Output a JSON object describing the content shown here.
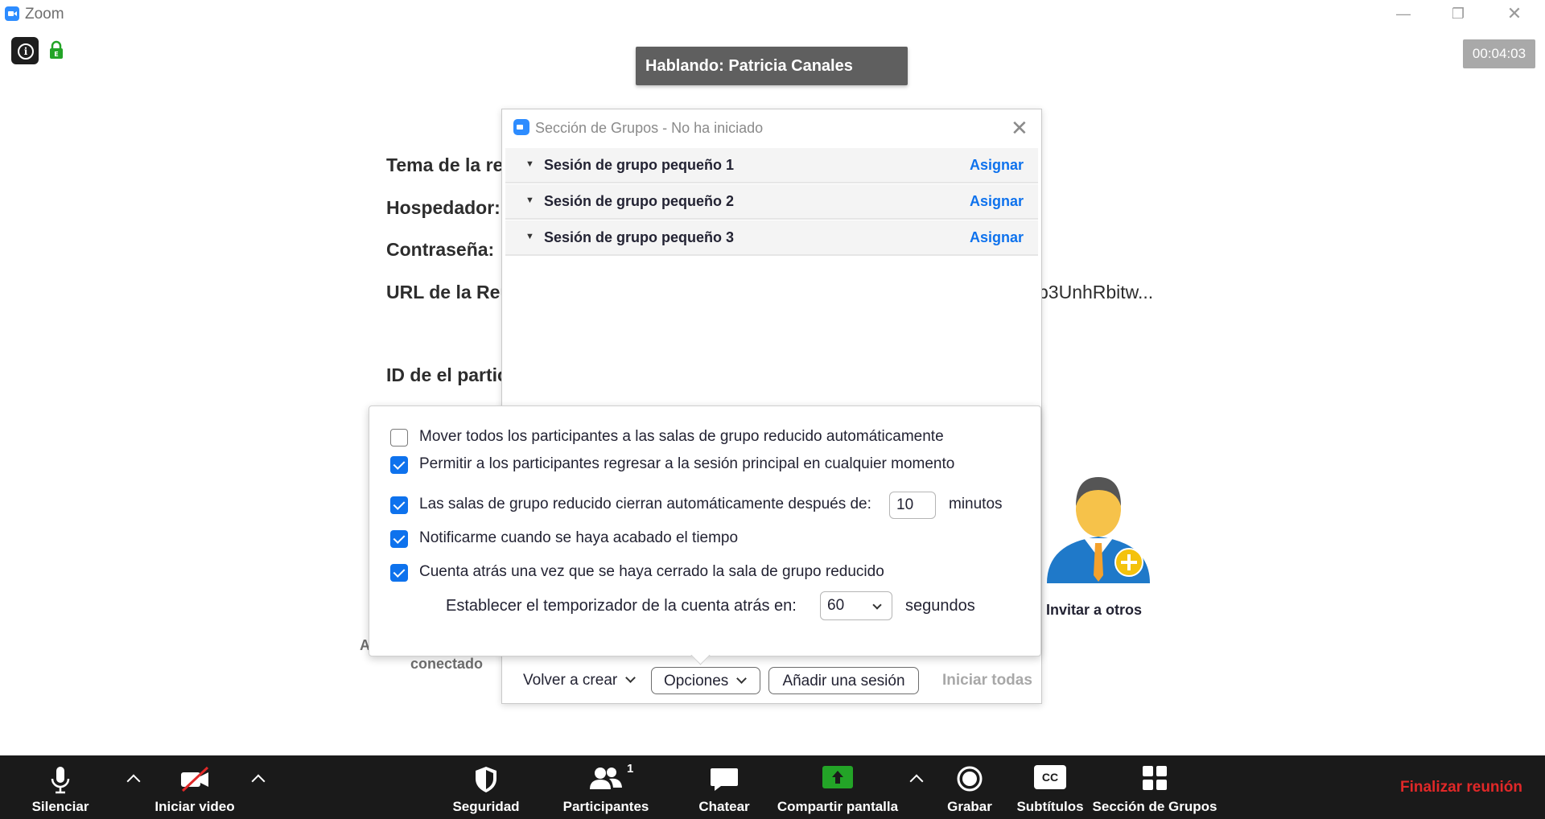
{
  "window": {
    "app_title": "Zoom",
    "timer": "00:04:03",
    "speaking": "Hablando: Patricia Canales"
  },
  "meeting_info": {
    "topic_label": "Tema de la re",
    "host_label": "Hospedador:",
    "password_label": "Contraseña:",
    "url_label": "URL de la Reu",
    "url_tail": "p3UnhRbitw...",
    "participant_id_label": "ID de el partic",
    "side_letter": "A",
    "connected": "conectado"
  },
  "invite": {
    "label": "Invitar a otros"
  },
  "breakout": {
    "title": "Sección de Grupos - No ha iniciado",
    "sessions": [
      {
        "name": "Sesión de grupo pequeño 1",
        "action": "Asignar"
      },
      {
        "name": "Sesión de grupo pequeño 2",
        "action": "Asignar"
      },
      {
        "name": "Sesión de grupo pequeño 3",
        "action": "Asignar"
      }
    ],
    "footer": {
      "recreate": "Volver a crear",
      "options": "Opciones",
      "add_session": "Añadir una sesión",
      "start_all": "Iniciar todas"
    },
    "options": {
      "auto_move": {
        "label": "Mover todos los participantes a las salas de grupo reducido automáticamente",
        "checked": false
      },
      "allow_return": {
        "label": "Permitir a los participantes regresar a la sesión principal en cualquier momento",
        "checked": true
      },
      "auto_close": {
        "label": "Las salas de grupo reducido cierran automáticamente después de:",
        "checked": true,
        "value": "10",
        "unit": "minutos"
      },
      "notify": {
        "label": "Notificarme cuando se haya acabado el tiempo",
        "checked": true
      },
      "countdown": {
        "label": "Cuenta atrás una vez que se haya cerrado la sala de grupo reducido",
        "checked": true
      },
      "countdown_timer": {
        "label": "Establecer el temporizador de la cuenta atrás en:",
        "value": "60",
        "unit": "segundos"
      }
    }
  },
  "toolbar": {
    "mute": "Silenciar",
    "video": "Iniciar video",
    "security": "Seguridad",
    "participants": "Participantes",
    "participants_count": "1",
    "chat": "Chatear",
    "share": "Compartir pantalla",
    "record": "Grabar",
    "captions": "Subtítulos",
    "cc": "CC",
    "breakout": "Sección de Grupos",
    "end": "Finalizar reunión"
  },
  "colors": {
    "accent": "#0e72ed",
    "zoom_blue": "#2d8cff",
    "end_red": "#e02828",
    "share_green": "#23a427",
    "toolbar_bg": "#1a1a1a"
  }
}
